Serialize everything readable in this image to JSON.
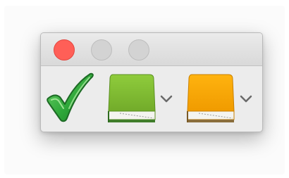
{
  "window": {
    "buttons": [
      {
        "name": "close",
        "color": "#ff5f57"
      },
      {
        "name": "minimize",
        "color": "#d3d3d3"
      },
      {
        "name": "zoom",
        "color": "#d3d3d3"
      }
    ]
  },
  "toolbar": {
    "items": [
      {
        "icon": "checkmark-icon",
        "color": "#3cae3c"
      },
      {
        "icon": "book-icon",
        "color": "#86c13b",
        "has_dropdown": true
      },
      {
        "icon": "book-icon",
        "color": "#f5a800",
        "has_dropdown": true
      }
    ]
  }
}
